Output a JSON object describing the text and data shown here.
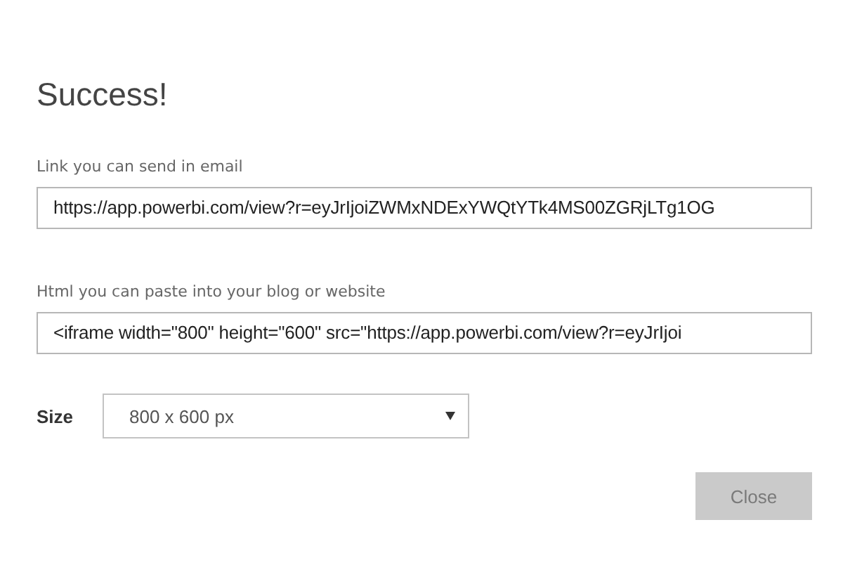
{
  "dialog": {
    "title": "Success!",
    "fields": [
      {
        "label": "Link you can send in email",
        "value": "https://app.powerbi.com/view?r=eyJrIjoiZWMxNDExYWQtYTk4MS00ZGRjLTg1OG"
      },
      {
        "label": "Html you can paste into your blog or website",
        "value": "<iframe width=\"800\" height=\"600\" src=\"https://app.powerbi.com/view?r=eyJrIjoi"
      }
    ],
    "size": {
      "label": "Size",
      "value": "800 x 600 px"
    },
    "buttons": [
      {
        "label": "Close",
        "disabled": true
      }
    ]
  }
}
